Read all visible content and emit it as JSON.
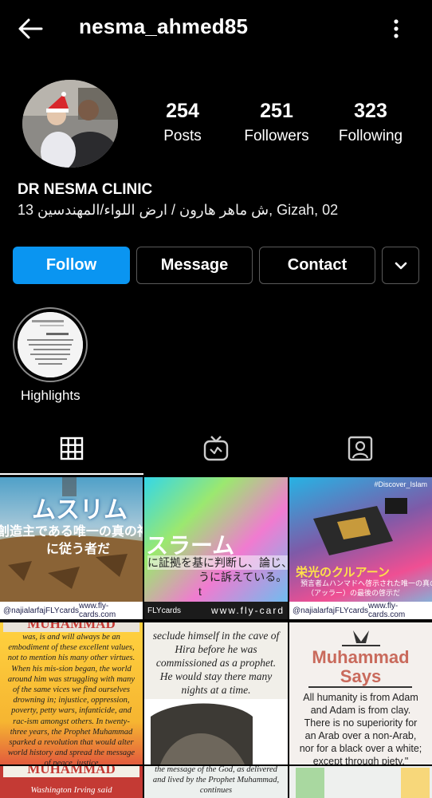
{
  "header": {
    "username": "nesma_ahmed85",
    "back_icon": "arrow-left-icon",
    "more_icon": "vertical-dots-icon"
  },
  "stats": {
    "posts": {
      "value": "254",
      "label": "Posts"
    },
    "followers": {
      "value": "251",
      "label": "Followers"
    },
    "following": {
      "value": "323",
      "label": "Following"
    }
  },
  "bio": {
    "name": "DR NESMA CLINIC",
    "address": "13 ش ماهر هارون / ارض اللواء/المهندسين, Gizah, 02"
  },
  "actions": {
    "follow": "Follow",
    "message": "Message",
    "contact": "Contact",
    "chevron_icon": "chevron-down-icon"
  },
  "highlights": [
    {
      "label": "Highlights"
    }
  ],
  "tabs": [
    {
      "icon": "grid-icon",
      "active": true
    },
    {
      "icon": "igtv-icon",
      "active": false
    },
    {
      "icon": "tagged-user-icon",
      "active": false
    }
  ],
  "colors": {
    "background": "#000000",
    "follow_button": "#0a95f1",
    "outline_border": "#5a5a5a"
  },
  "posts": [
    {
      "title": "ムスリム",
      "line1": "創造主である唯一の真の神",
      "line2": "に従う者だ",
      "handle": "@najialarfaj",
      "brand": "FLYcards",
      "url": "www.fly-cards.com"
    },
    {
      "title": "スラーム",
      "line1": "に証拠を基に判断し、論じ、思い",
      "line2": "うに訴えている。t",
      "brand": "FLYcards",
      "url": "www.fly-card"
    },
    {
      "tag": "#Discover_Islam",
      "title": "栄光のクルアーン",
      "line1": "預言者ムハンマドへ啓示された唯一の真の神",
      "line2": "（アッラー）の最後の啓示だ",
      "handle": "@najialarfaj",
      "brand": "FLYcards",
      "url": "www.fly-cards.com"
    },
    {
      "banner": "MUHAMMAD",
      "text": "was, is and will always be an embodiment of these excellent values, not to mention his many other virtues. When his mis-sion began, the world around him was struggling with many of the same vices we find ourselves drowning in; injustice, oppression, poverty, petty wars, infanticide, and rac-ism amongst others. In twenty-three years, the Prophet Muhammad sparked a revolution that would alter world history and spread the message of peace, justice"
    },
    {
      "text": "seclude himself in the cave of Hira before he was commissioned as a prophet. He would stay there many nights at a time."
    },
    {
      "title": "Muhammad Says",
      "text": "All humanity is from Adam and Adam is from clay. There is no superiority for an Arab over a non-Arab, nor for a black over a white; except through piety.\""
    },
    {
      "banner": "MUHAMMAD",
      "text": "Washington Irving said"
    },
    {
      "text": "the message of the God, as delivered and lived by the Prophet Muhammad, continues"
    },
    {}
  ]
}
